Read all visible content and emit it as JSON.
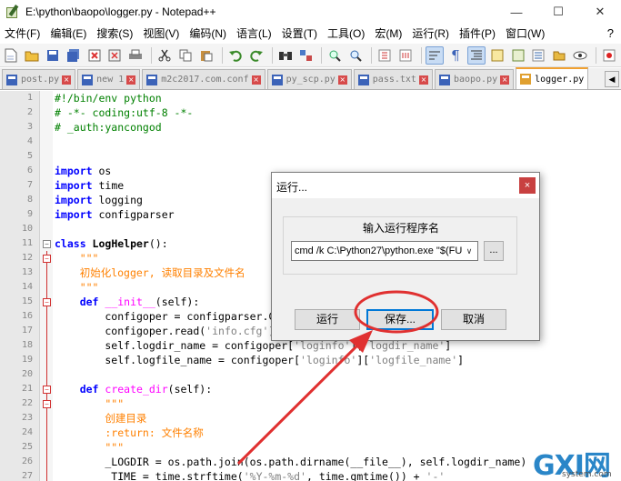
{
  "window": {
    "title": "E:\\python\\baopo\\logger.py - Notepad++",
    "minimize": "—",
    "maximize": "☐",
    "close": "✕"
  },
  "menu": [
    "文件(F)",
    "编辑(E)",
    "搜索(S)",
    "视图(V)",
    "编码(N)",
    "语言(L)",
    "设置(T)",
    "工具(O)",
    "宏(M)",
    "运行(R)",
    "插件(P)",
    "窗口(W)"
  ],
  "menu_help": "?",
  "tabs": [
    {
      "label": "post.py",
      "active": false
    },
    {
      "label": "new 1",
      "active": false
    },
    {
      "label": "m2c2017.com.conf",
      "active": false
    },
    {
      "label": "py_scp.py",
      "active": false
    },
    {
      "label": "pass.txt",
      "active": false
    },
    {
      "label": "baopo.py",
      "active": false
    },
    {
      "label": "logger.py",
      "active": true
    }
  ],
  "code_lines": [
    {
      "n": "1",
      "parts": [
        [
          "c-com",
          "#!/bin/env python"
        ]
      ]
    },
    {
      "n": "2",
      "parts": [
        [
          "c-com",
          "# -*- coding:utf-8 -*-"
        ]
      ]
    },
    {
      "n": "3",
      "parts": [
        [
          "c-com",
          "# _auth:yancongod"
        ]
      ]
    },
    {
      "n": "4",
      "parts": []
    },
    {
      "n": "5",
      "parts": []
    },
    {
      "n": "6",
      "parts": [
        [
          "c-kw",
          "import"
        ],
        [
          "",
          " os"
        ]
      ]
    },
    {
      "n": "7",
      "parts": [
        [
          "c-kw",
          "import"
        ],
        [
          "",
          " time"
        ]
      ]
    },
    {
      "n": "8",
      "parts": [
        [
          "c-kw",
          "import"
        ],
        [
          "",
          " logging"
        ]
      ]
    },
    {
      "n": "9",
      "parts": [
        [
          "c-kw",
          "import"
        ],
        [
          "",
          " configparser"
        ]
      ]
    },
    {
      "n": "10",
      "parts": []
    },
    {
      "n": "11",
      "parts": [
        [
          "c-kw",
          "class"
        ],
        [
          "c-fn",
          " LogHelper"
        ],
        [
          "",
          "():"
        ]
      ]
    },
    {
      "n": "12",
      "parts": [
        [
          "c-doc",
          "    \"\"\""
        ]
      ]
    },
    {
      "n": "13",
      "parts": [
        [
          "c-doc",
          "    初始化logger, 读取目录及文件名"
        ]
      ]
    },
    {
      "n": "14",
      "parts": [
        [
          "c-doc",
          "    \"\"\""
        ]
      ]
    },
    {
      "n": "15",
      "parts": [
        [
          "",
          "    "
        ],
        [
          "c-kw",
          "def"
        ],
        [
          "c-def",
          " __init__"
        ],
        [
          "",
          "(self):"
        ]
      ]
    },
    {
      "n": "16",
      "parts": [
        [
          "",
          "        configoper = configparser.C"
        ]
      ]
    },
    {
      "n": "17",
      "parts": [
        [
          "",
          "        configoper.read("
        ],
        [
          "c-str",
          "'info.cfg'"
        ],
        [
          "",
          ")"
        ]
      ]
    },
    {
      "n": "18",
      "parts": [
        [
          "",
          "        self.logdir_name = configoper["
        ],
        [
          "c-str",
          "'loginfo'"
        ],
        [
          "",
          "]["
        ],
        [
          "c-str",
          "'logdir_name'"
        ],
        [
          "",
          "]"
        ]
      ]
    },
    {
      "n": "19",
      "parts": [
        [
          "",
          "        self.logfile_name = configoper["
        ],
        [
          "c-str",
          "'loginfo'"
        ],
        [
          "",
          "]["
        ],
        [
          "c-str",
          "'logfile_name'"
        ],
        [
          "",
          "]"
        ]
      ]
    },
    {
      "n": "20",
      "parts": []
    },
    {
      "n": "21",
      "parts": [
        [
          "",
          "    "
        ],
        [
          "c-kw",
          "def"
        ],
        [
          "c-def",
          " create_dir"
        ],
        [
          "",
          "(self):"
        ]
      ]
    },
    {
      "n": "22",
      "parts": [
        [
          "c-doc",
          "        \"\"\""
        ]
      ]
    },
    {
      "n": "23",
      "parts": [
        [
          "c-doc",
          "        创建目录"
        ]
      ]
    },
    {
      "n": "24",
      "parts": [
        [
          "c-doc",
          "        :return: 文件名称"
        ]
      ]
    },
    {
      "n": "25",
      "parts": [
        [
          "c-doc",
          "        \"\"\""
        ]
      ]
    },
    {
      "n": "26",
      "parts": [
        [
          "",
          "        _LOGDIR = os.path.join(os.path.dirname(__file__), self.logdir_name)"
        ]
      ]
    },
    {
      "n": "27",
      "parts": [
        [
          "",
          "        _TIME = time.strftime("
        ],
        [
          "c-str",
          "'%Y-%m-%d'"
        ],
        [
          "",
          ", time.gmtime()) + "
        ],
        [
          "c-str",
          "'-'"
        ]
      ]
    }
  ],
  "dialog": {
    "title": "运行...",
    "close": "×",
    "group_label": "输入运行程序名",
    "command": "cmd /k C:\\Python27\\python.exe \"$(FU",
    "browse": "...",
    "run_label": "运行",
    "save_label": "保存...",
    "cancel_label": "取消"
  },
  "watermark": {
    "big": "GXI网",
    "small": "system.com"
  }
}
